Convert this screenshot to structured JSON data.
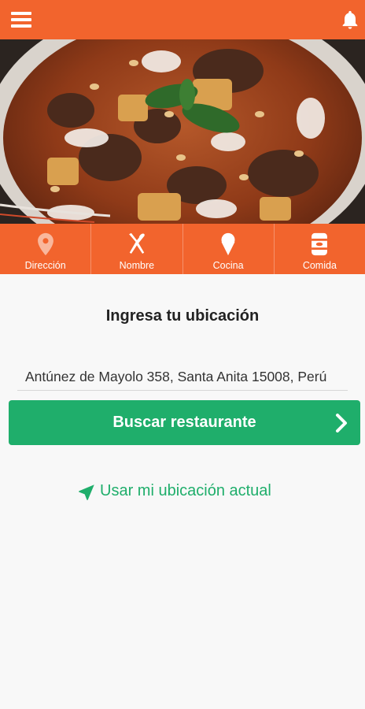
{
  "topbar": {
    "menu_icon": "hamburger-menu-icon",
    "notification_icon": "bell-icon",
    "color": "#f2642d"
  },
  "hero": {
    "image": "food dish photo (curry with meat, potatoes, peanuts and basil)"
  },
  "categories": [
    {
      "label": "Dirección",
      "icon": "location-pin-icon"
    },
    {
      "label": "Nombre",
      "icon": "fork-spoon-icon"
    },
    {
      "label": "Cocina",
      "icon": "ice-cream-cone-icon"
    },
    {
      "label": "Comida",
      "icon": "can-icon"
    }
  ],
  "main": {
    "title": "Ingresa tu ubicación",
    "address_value": "Antúnez de Mayolo 358, Santa Anita 15008, Perú",
    "search_button_label": "Buscar restaurante",
    "use_location_label": "Usar mi ubicación actual"
  },
  "colors": {
    "accent": "#f2642d",
    "primary_button": "#1fae6b",
    "link": "#1fae6b"
  }
}
